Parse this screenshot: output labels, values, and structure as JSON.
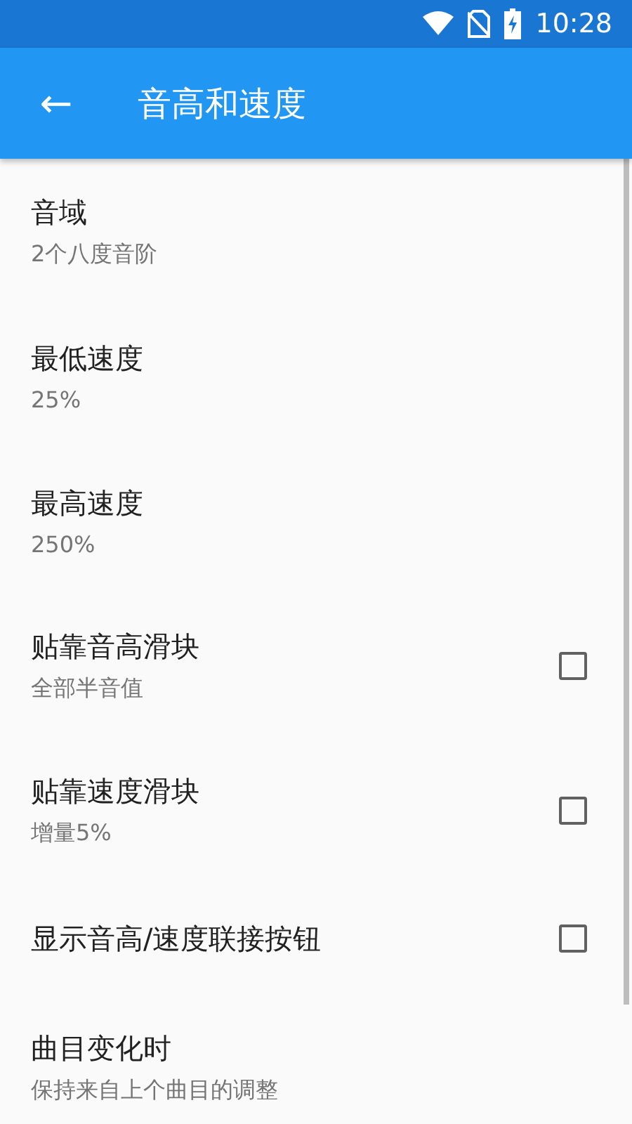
{
  "status_bar": {
    "time": "10:28"
  },
  "app_bar": {
    "back": "←",
    "title": "音高和速度"
  },
  "settings": [
    {
      "kind": "text",
      "title": "音域",
      "summary": "2个八度音阶"
    },
    {
      "kind": "text",
      "title": "最低速度",
      "summary": "25%"
    },
    {
      "kind": "text",
      "title": "最高速度",
      "summary": "250%"
    },
    {
      "kind": "checkbox",
      "title": "贴靠音高滑块",
      "summary": "全部半音值",
      "checked": false
    },
    {
      "kind": "checkbox",
      "title": "贴靠速度滑块",
      "summary": "增量5%",
      "checked": false
    },
    {
      "kind": "checkbox",
      "title": "显示音高/速度联接按钮",
      "checked": false
    },
    {
      "kind": "text",
      "title": "曲目变化时",
      "summary": "保持来自上个曲目的调整"
    }
  ]
}
